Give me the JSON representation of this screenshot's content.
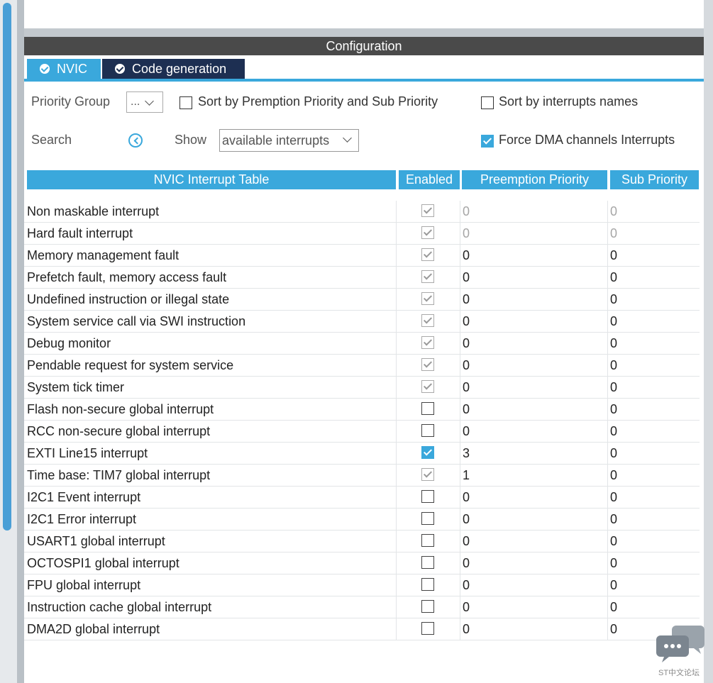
{
  "panel_title": "Configuration",
  "tabs": [
    {
      "label": "NVIC",
      "active": true
    },
    {
      "label": "Code generation",
      "active": false
    }
  ],
  "controls": {
    "priority_group_label": "Priority Group",
    "priority_group_value": "...",
    "sort_premption_label": "Sort by Premption Priority and Sub Priority",
    "sort_premption_checked": false,
    "sort_names_label": "Sort by interrupts names",
    "sort_names_checked": false,
    "search_label": "Search",
    "show_label": "Show",
    "show_value": "available interrupts",
    "force_dma_label": "Force DMA channels Interrupts",
    "force_dma_checked": true
  },
  "table": {
    "headers": [
      "NVIC Interrupt Table",
      "Enabled",
      "Preemption Priority",
      "Sub Priority"
    ],
    "rows": [
      {
        "name": "Non maskable interrupt",
        "enabled": "locked-checked",
        "preemption": "0",
        "sub": "0",
        "editable": false
      },
      {
        "name": "Hard fault interrupt",
        "enabled": "locked-checked",
        "preemption": "0",
        "sub": "0",
        "editable": false
      },
      {
        "name": "Memory management fault",
        "enabled": "locked-checked",
        "preemption": "0",
        "sub": "0",
        "editable": true
      },
      {
        "name": "Prefetch fault, memory access fault",
        "enabled": "locked-checked",
        "preemption": "0",
        "sub": "0",
        "editable": true
      },
      {
        "name": "Undefined instruction or illegal state",
        "enabled": "locked-checked",
        "preemption": "0",
        "sub": "0",
        "editable": true
      },
      {
        "name": "System service call via SWI instruction",
        "enabled": "locked-checked",
        "preemption": "0",
        "sub": "0",
        "editable": true
      },
      {
        "name": "Debug monitor",
        "enabled": "locked-checked",
        "preemption": "0",
        "sub": "0",
        "editable": true
      },
      {
        "name": "Pendable request for system service",
        "enabled": "locked-checked",
        "preemption": "0",
        "sub": "0",
        "editable": true
      },
      {
        "name": "System tick timer",
        "enabled": "locked-checked",
        "preemption": "0",
        "sub": "0",
        "editable": true
      },
      {
        "name": "Flash non-secure global interrupt",
        "enabled": "unchecked",
        "preemption": "0",
        "sub": "0",
        "editable": true
      },
      {
        "name": "RCC non-secure global interrupt",
        "enabled": "unchecked",
        "preemption": "0",
        "sub": "0",
        "editable": true
      },
      {
        "name": "EXTI Line15 interrupt",
        "enabled": "checked",
        "preemption": "3",
        "sub": "0",
        "editable": true
      },
      {
        "name": "Time base: TIM7 global interrupt",
        "enabled": "locked-checked",
        "preemption": "1",
        "sub": "0",
        "editable": true
      },
      {
        "name": "I2C1 Event interrupt",
        "enabled": "unchecked",
        "preemption": "0",
        "sub": "0",
        "editable": true
      },
      {
        "name": "I2C1 Error interrupt",
        "enabled": "unchecked",
        "preemption": "0",
        "sub": "0",
        "editable": true
      },
      {
        "name": "USART1 global interrupt",
        "enabled": "unchecked",
        "preemption": "0",
        "sub": "0",
        "editable": true
      },
      {
        "name": "OCTOSPI1 global interrupt",
        "enabled": "unchecked",
        "preemption": "0",
        "sub": "0",
        "editable": true
      },
      {
        "name": "FPU global interrupt",
        "enabled": "unchecked",
        "preemption": "0",
        "sub": "0",
        "editable": true
      },
      {
        "name": "Instruction cache global interrupt",
        "enabled": "unchecked",
        "preemption": "0",
        "sub": "0",
        "editable": true
      },
      {
        "name": "DMA2D global interrupt",
        "enabled": "unchecked",
        "preemption": "0",
        "sub": "0",
        "editable": true
      }
    ]
  },
  "watermark": {
    "text": "ST中文论坛",
    "icon": "chat-bubbles-icon"
  },
  "colors": {
    "accent": "#3aa8dc",
    "dark_tab": "#1d2f52",
    "header_bar": "#4a4a4a"
  }
}
